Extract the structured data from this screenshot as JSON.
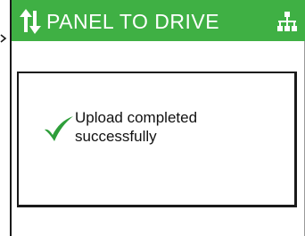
{
  "titlebar": {
    "title": "PANEL TO DRIVE",
    "left_icon": "up-down-arrows-icon",
    "right_icon": "network-hierarchy-icon",
    "background_color": "#3fb044",
    "text_color": "#ffffff"
  },
  "dialog": {
    "icon": "checkmark-icon",
    "icon_color": "#2e9e3a",
    "message": "Upload completed\nsuccessfully"
  }
}
